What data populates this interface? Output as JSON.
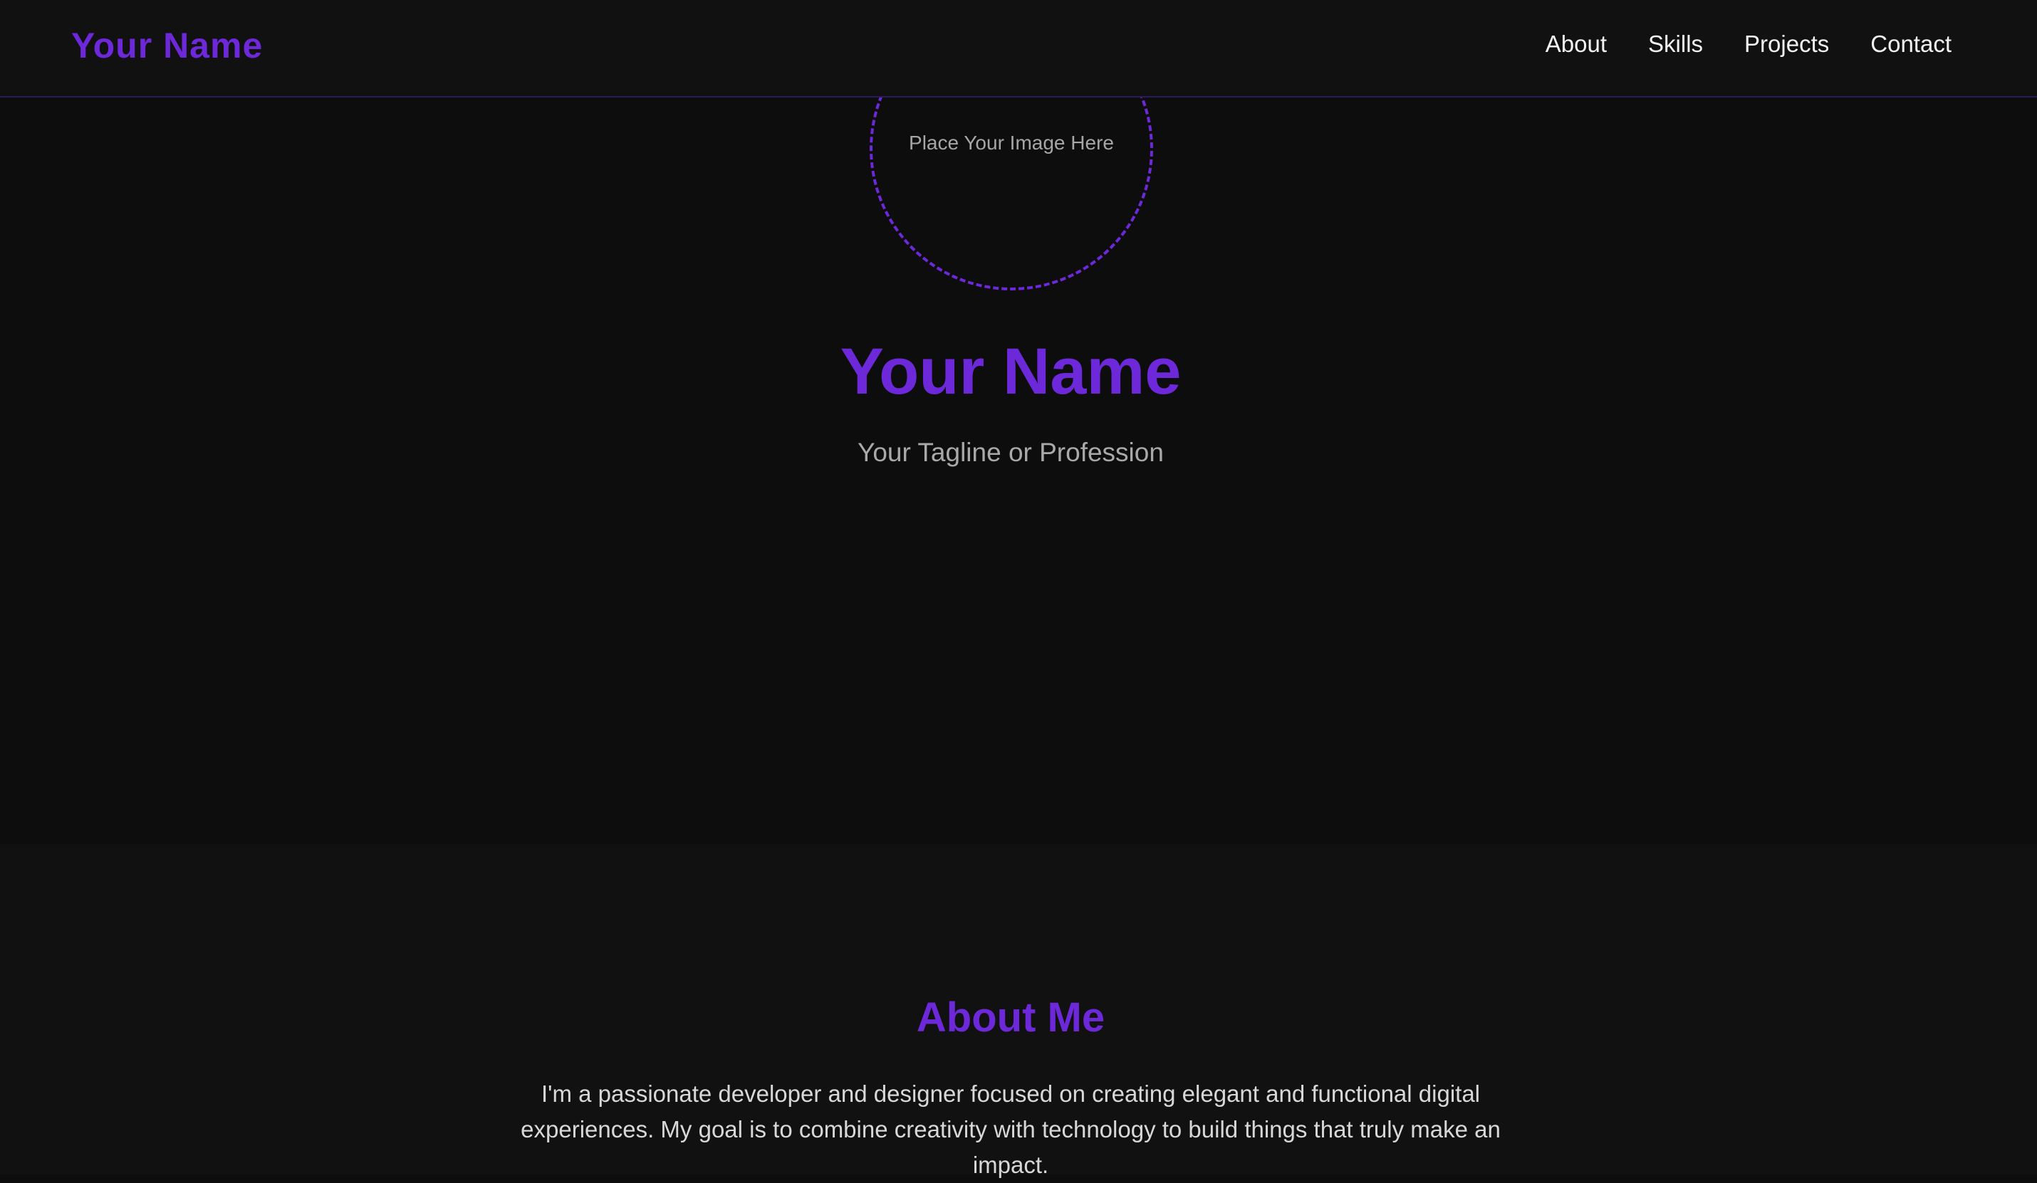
{
  "navbar": {
    "brand": "Your Name",
    "links": [
      {
        "label": "About"
      },
      {
        "label": "Skills"
      },
      {
        "label": "Projects"
      },
      {
        "label": "Contact"
      }
    ]
  },
  "hero": {
    "image_placeholder": "Place Your Image Here",
    "name": "Your Name",
    "tagline": "Your Tagline or Profession"
  },
  "about": {
    "title": "About Me",
    "body": "I'm a passionate developer and designer focused on creating elegant and functional digital experiences. My goal is to combine creativity with technology to build things that truly make an impact."
  },
  "colors": {
    "accent": "#6d28d9",
    "background": "#0d0d0d",
    "surface": "#111111",
    "text": "#f2f2f2",
    "muted_text": "#a9a9a9"
  }
}
